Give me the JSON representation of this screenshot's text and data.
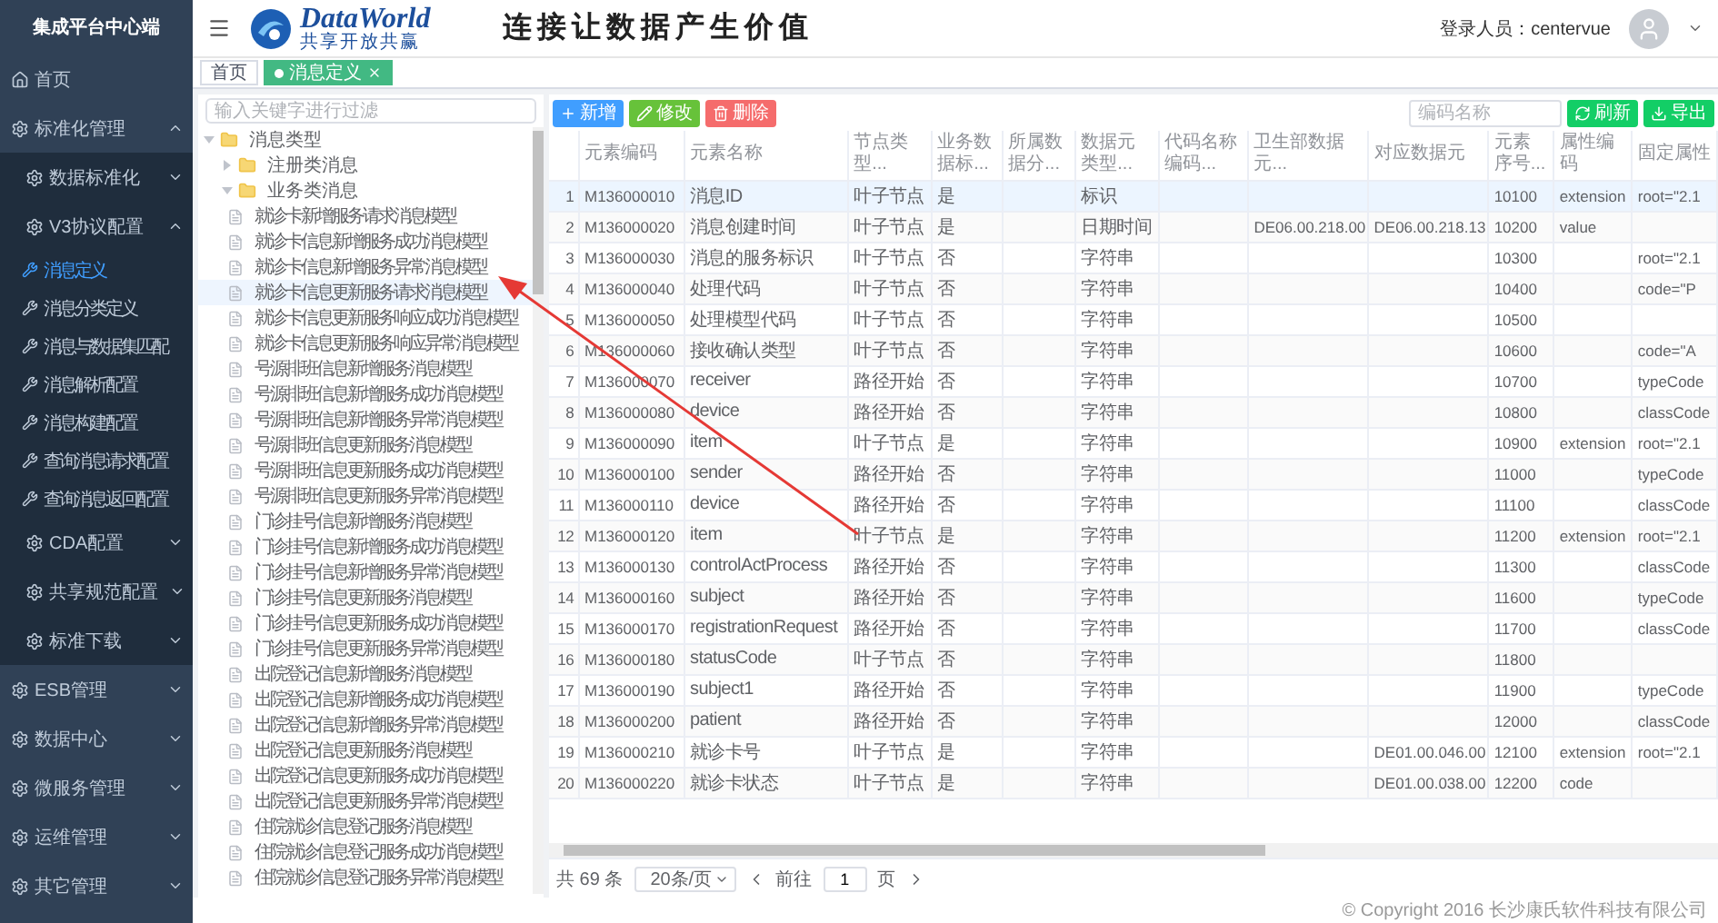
{
  "sidebar": {
    "title": "集成平台中心端",
    "home": {
      "label": "首页"
    },
    "groups": [
      {
        "label": "标准化管理",
        "expanded": true,
        "children": [
          {
            "label": "数据标准化",
            "expanded": false
          },
          {
            "label": "V3协议配置",
            "expanded": true,
            "children": [
              {
                "label": "消息定义",
                "selected": true
              },
              {
                "label": "消息分类定义",
                "selected": false
              },
              {
                "label": "消息与数据集匹配",
                "selected": false
              },
              {
                "label": "消息解析配置",
                "selected": false
              },
              {
                "label": "消息构建配置",
                "selected": false
              },
              {
                "label": "查询消息请求配置",
                "selected": false
              },
              {
                "label": "查询消息返回配置",
                "selected": false
              }
            ]
          },
          {
            "label": "CDA配置",
            "expanded": false
          },
          {
            "label": "共享规范配置",
            "expanded": false
          },
          {
            "label": "标准下载",
            "expanded": false
          }
        ]
      },
      {
        "label": "ESB管理",
        "expanded": false
      },
      {
        "label": "数据中心",
        "expanded": false
      },
      {
        "label": "微服务管理",
        "expanded": false
      },
      {
        "label": "运维管理",
        "expanded": false
      },
      {
        "label": "其它管理",
        "expanded": false
      }
    ]
  },
  "header": {
    "logo": {
      "name": "DataWorld",
      "tagline": "共享开放共赢"
    },
    "slogan": "连接让数据产生价值",
    "user": "登录人员：centervue"
  },
  "tabs": [
    {
      "label": "首页",
      "selected": false,
      "closable": false
    },
    {
      "label": "消息定义",
      "selected": true,
      "closable": true
    }
  ],
  "tree": {
    "placeholder": "输入关键字进行过滤",
    "nodes": [
      {
        "label": "消息类型",
        "kind": "folder",
        "expanded": true,
        "selected": false,
        "children": [
          {
            "label": "注册类消息",
            "kind": "folder",
            "expanded": false,
            "selected": false
          },
          {
            "label": "业务类消息",
            "kind": "folder",
            "expanded": true,
            "selected": false,
            "children": [
              {
                "label": "就诊卡新增服务请求消息模型",
                "kind": "file",
                "selected": false
              },
              {
                "label": "就诊卡信息新增服务成功消息模型",
                "kind": "file",
                "selected": false
              },
              {
                "label": "就诊卡信息新增服务异常消息模型",
                "kind": "file",
                "selected": false
              },
              {
                "label": "就诊卡信息更新服务请求消息模型",
                "kind": "file",
                "selected": true
              },
              {
                "label": "就诊卡信息更新服务响应成功消息模型",
                "kind": "file",
                "selected": false
              },
              {
                "label": "就诊卡信息更新服务响应异常消息模型",
                "kind": "file",
                "selected": false
              },
              {
                "label": "号源排班信息新增服务消息模型",
                "kind": "file",
                "selected": false
              },
              {
                "label": "号源排班信息新增服务成功消息模型",
                "kind": "file",
                "selected": false
              },
              {
                "label": "号源排班信息新增服务异常消息模型",
                "kind": "file",
                "selected": false
              },
              {
                "label": "号源排班信息更新服务消息模型",
                "kind": "file",
                "selected": false
              },
              {
                "label": "号源排班信息更新服务成功消息模型",
                "kind": "file",
                "selected": false
              },
              {
                "label": "号源排班信息更新服务异常消息模型",
                "kind": "file",
                "selected": false
              },
              {
                "label": "门诊挂号信息新增服务消息模型",
                "kind": "file",
                "selected": false
              },
              {
                "label": "门诊挂号信息新增服务成功消息模型",
                "kind": "file",
                "selected": false
              },
              {
                "label": "门诊挂号信息新增服务异常消息模型",
                "kind": "file",
                "selected": false
              },
              {
                "label": "门诊挂号信息更新服务消息模型",
                "kind": "file",
                "selected": false
              },
              {
                "label": "门诊挂号信息更新服务成功消息模型",
                "kind": "file",
                "selected": false
              },
              {
                "label": "门诊挂号信息更新服务异常消息模型",
                "kind": "file",
                "selected": false
              },
              {
                "label": "出院登记信息新增服务消息模型",
                "kind": "file",
                "selected": false
              },
              {
                "label": "出院登记信息新增服务成功消息模型",
                "kind": "file",
                "selected": false
              },
              {
                "label": "出院登记信息新增服务异常消息模型",
                "kind": "file",
                "selected": false
              },
              {
                "label": "出院登记信息更新服务消息模型",
                "kind": "file",
                "selected": false
              },
              {
                "label": "出院登记信息更新服务成功消息模型",
                "kind": "file",
                "selected": false
              },
              {
                "label": "出院登记信息更新服务异常消息模型",
                "kind": "file",
                "selected": false
              },
              {
                "label": "住院就诊信息登记服务消息模型",
                "kind": "file",
                "selected": false
              },
              {
                "label": "住院就诊信息登记服务成功消息模型",
                "kind": "file",
                "selected": false
              },
              {
                "label": "住院就诊信息登记服务异常消息模型",
                "kind": "file",
                "selected": false
              }
            ]
          }
        ]
      }
    ]
  },
  "toolbar": {
    "actions": [
      {
        "label": "新增",
        "kind": "add"
      },
      {
        "label": "修改",
        "kind": "edit"
      },
      {
        "label": "删除",
        "kind": "delete"
      }
    ],
    "search": {
      "placeholder": "编码名称"
    },
    "tools": [
      {
        "label": "刷新",
        "kind": "refresh"
      },
      {
        "label": "导出",
        "kind": "export"
      }
    ]
  },
  "table": {
    "columns": [
      {
        "label": "元素编码",
        "kind": "code"
      },
      {
        "label": "元素名称",
        "kind": "text"
      },
      {
        "label": "节点类型...",
        "kind": "text"
      },
      {
        "label": "业务数据标...",
        "kind": "text"
      },
      {
        "label": "所属数据分...",
        "kind": "text"
      },
      {
        "label": "数据元类型...",
        "kind": "text"
      },
      {
        "label": "代码名称编码...",
        "kind": "text"
      },
      {
        "label": "卫生部数据元...",
        "kind": "code"
      },
      {
        "label": "对应数据元",
        "kind": "code"
      },
      {
        "label": "元素序号...",
        "kind": "code"
      },
      {
        "label": "属性编码",
        "kind": "code"
      },
      {
        "label": "固定属性",
        "kind": "code"
      }
    ],
    "rows": [
      {
        "index": "1",
        "selected": true,
        "cells": [
          "M136000010",
          "消息ID",
          "叶子节点",
          "是",
          null,
          "标识",
          null,
          null,
          null,
          "10100",
          "extension",
          "root=\"2.1"
        ]
      },
      {
        "index": "2",
        "selected": false,
        "cells": [
          "M136000020",
          "消息创建时间",
          "叶子节点",
          "是",
          null,
          "日期时间",
          null,
          "DE06.00.218.00",
          "DE06.00.218.13",
          "10200",
          "value",
          null
        ]
      },
      {
        "index": "3",
        "selected": false,
        "cells": [
          "M136000030",
          "消息的服务标识",
          "叶子节点",
          "否",
          null,
          "字符串",
          null,
          null,
          null,
          "10300",
          null,
          "root=\"2.1"
        ]
      },
      {
        "index": "4",
        "selected": false,
        "cells": [
          "M136000040",
          "处理代码",
          "叶子节点",
          "否",
          null,
          "字符串",
          null,
          null,
          null,
          "10400",
          null,
          "code=\"P"
        ]
      },
      {
        "index": "5",
        "selected": false,
        "cells": [
          "M136000050",
          "处理模型代码",
          "叶子节点",
          "否",
          null,
          "字符串",
          null,
          null,
          null,
          "10500",
          null,
          null
        ]
      },
      {
        "index": "6",
        "selected": false,
        "cells": [
          "M136000060",
          "接收确认类型",
          "叶子节点",
          "否",
          null,
          "字符串",
          null,
          null,
          null,
          "10600",
          null,
          "code=\"A"
        ]
      },
      {
        "index": "7",
        "selected": false,
        "cells": [
          "M136000070",
          "receiver",
          "路径开始",
          "否",
          null,
          "字符串",
          null,
          null,
          null,
          "10700",
          null,
          "typeCode"
        ]
      },
      {
        "index": "8",
        "selected": false,
        "cells": [
          "M136000080",
          "device",
          "路径开始",
          "否",
          null,
          "字符串",
          null,
          null,
          null,
          "10800",
          null,
          "classCode"
        ]
      },
      {
        "index": "9",
        "selected": false,
        "cells": [
          "M136000090",
          "item",
          "叶子节点",
          "是",
          null,
          "字符串",
          null,
          null,
          null,
          "10900",
          "extension",
          "root=\"2.1"
        ]
      },
      {
        "index": "10",
        "selected": false,
        "cells": [
          "M136000100",
          "sender",
          "路径开始",
          "否",
          null,
          "字符串",
          null,
          null,
          null,
          "11000",
          null,
          "typeCode"
        ]
      },
      {
        "index": "11",
        "selected": false,
        "cells": [
          "M136000110",
          "device",
          "路径开始",
          "否",
          null,
          "字符串",
          null,
          null,
          null,
          "11100",
          null,
          "classCode"
        ]
      },
      {
        "index": "12",
        "selected": false,
        "cells": [
          "M136000120",
          "item",
          "叶子节点",
          "是",
          null,
          "字符串",
          null,
          null,
          null,
          "11200",
          "extension",
          "root=\"2.1"
        ]
      },
      {
        "index": "13",
        "selected": false,
        "cells": [
          "M136000130",
          "controlActProcess",
          "路径开始",
          "否",
          null,
          "字符串",
          null,
          null,
          null,
          "11300",
          null,
          "classCode"
        ]
      },
      {
        "index": "14",
        "selected": false,
        "cells": [
          "M136000160",
          "subject",
          "路径开始",
          "否",
          null,
          "字符串",
          null,
          null,
          null,
          "11600",
          null,
          "typeCode"
        ]
      },
      {
        "index": "15",
        "selected": false,
        "cells": [
          "M136000170",
          "registrationRequest",
          "路径开始",
          "否",
          null,
          "字符串",
          null,
          null,
          null,
          "11700",
          null,
          "classCode"
        ]
      },
      {
        "index": "16",
        "selected": false,
        "cells": [
          "M136000180",
          "statusCode",
          "叶子节点",
          "否",
          null,
          "字符串",
          null,
          null,
          null,
          "11800",
          null,
          null
        ]
      },
      {
        "index": "17",
        "selected": false,
        "cells": [
          "M136000190",
          "subject1",
          "路径开始",
          "否",
          null,
          "字符串",
          null,
          null,
          null,
          "11900",
          null,
          "typeCode"
        ]
      },
      {
        "index": "18",
        "selected": false,
        "cells": [
          "M136000200",
          "patient",
          "路径开始",
          "否",
          null,
          "字符串",
          null,
          null,
          null,
          "12000",
          null,
          "classCode"
        ]
      },
      {
        "index": "19",
        "selected": false,
        "cells": [
          "M136000210",
          "就诊卡号",
          "叶子节点",
          "是",
          null,
          "字符串",
          null,
          null,
          "DE01.00.046.00",
          "12100",
          "extension",
          "root=\"2.1"
        ]
      },
      {
        "index": "20",
        "selected": false,
        "cells": [
          "M136000220",
          "就诊卡状态",
          "叶子节点",
          "是",
          null,
          "字符串",
          null,
          null,
          "DE01.00.038.00",
          "12200",
          "code",
          null
        ]
      }
    ]
  },
  "pagination": {
    "total": "共 69 条",
    "page_size": "20条/页",
    "goto_label": "前往",
    "page": "1",
    "page_suffix": "页"
  },
  "footer": "© Copyright 2016 长沙康氏软件科技有限公司"
}
